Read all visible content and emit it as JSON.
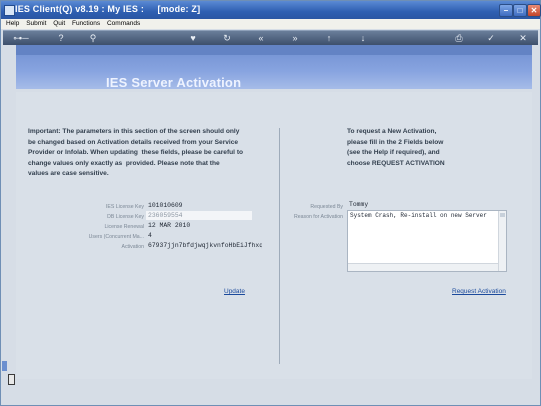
{
  "window": {
    "title": "IES Client(Q) v8.19 : My IES :     [mode: Z]",
    "min": "–",
    "max": "□",
    "close": "✕"
  },
  "menu": [
    "Help",
    "Submit",
    "Quit",
    "Functions",
    "Commands"
  ],
  "page": {
    "title": "IES Server Activation"
  },
  "left": {
    "note": "Important: The parameters in this section of the screen should only\nbe changed based on Activation details received from your Service\nProvider or Infolab. When updating  these fields, please be careful to\nchange values only exactly as  provided. Please note that the\nvalues are case sensitive.",
    "fields": [
      {
        "label": "IES License Key",
        "value": "101010609"
      },
      {
        "label": "DB License Key",
        "value": "236059554"
      },
      {
        "label": "License Renewal",
        "value": "12 MAR 2010"
      },
      {
        "label": "Users (Concurrent Ma...",
        "value": "4"
      },
      {
        "label": "Activation",
        "value": "67937jjn7bfdjwqjkvnfoHbEiJfhxqzzB"
      }
    ],
    "update_link": "Update"
  },
  "right": {
    "note": "To request a New Activation,\nplease fill in the 2 Fields below\n(see the Help if required), and\nchoose REQUEST ACTIVATION",
    "requested_by_label": "Requested By",
    "requested_by_value": "Tommy",
    "reason_label": "Reason for Activation",
    "reason_value": "System Crash, Re-install on new Server",
    "request_link": "Request Activation"
  }
}
